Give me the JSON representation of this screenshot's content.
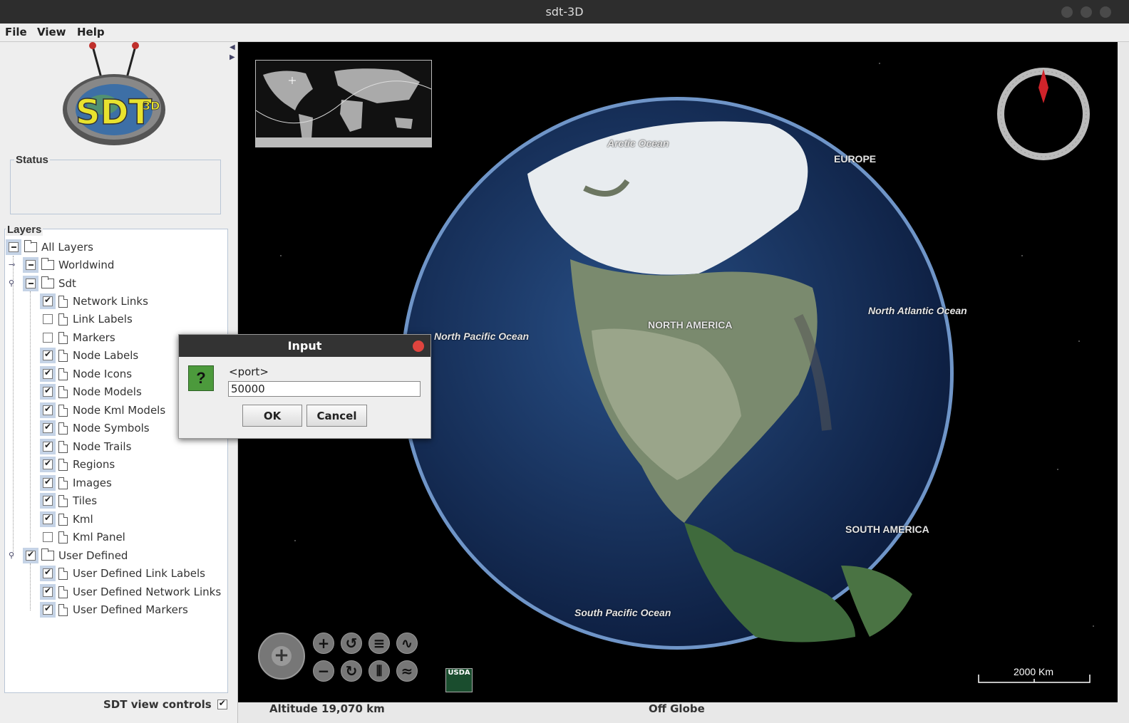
{
  "window": {
    "title": "sdt-3D"
  },
  "menu": {
    "file": "File",
    "view": "View",
    "help": "Help"
  },
  "left": {
    "status_label": "Status",
    "layers_label": "Layers",
    "view_controls_label": "SDT view controls",
    "view_controls_checked": true
  },
  "layers": {
    "all": {
      "label": "All Layers",
      "state": "minus"
    },
    "worldwind": {
      "label": "Worldwind",
      "state": "minus"
    },
    "sdt": {
      "label": "Sdt",
      "state": "minus"
    },
    "sdt_children": [
      {
        "label": "Network Links",
        "checked": true
      },
      {
        "label": "Link Labels",
        "checked": false
      },
      {
        "label": "Markers",
        "checked": false
      },
      {
        "label": "Node Labels",
        "checked": true
      },
      {
        "label": "Node Icons",
        "checked": true
      },
      {
        "label": "Node Models",
        "checked": true
      },
      {
        "label": "Node Kml Models",
        "checked": true
      },
      {
        "label": "Node Symbols",
        "checked": true
      },
      {
        "label": "Node Trails",
        "checked": true
      },
      {
        "label": "Regions",
        "checked": true
      },
      {
        "label": "Images",
        "checked": true
      },
      {
        "label": "Tiles",
        "checked": true
      },
      {
        "label": "Kml",
        "checked": true
      },
      {
        "label": "Kml Panel",
        "checked": false
      }
    ],
    "user_defined": {
      "label": "User Defined",
      "state": "checked"
    },
    "user_children": [
      {
        "label": "User Defined Link Labels",
        "checked": true
      },
      {
        "label": "User Defined Network Links",
        "checked": true
      },
      {
        "label": "User Defined Markers",
        "checked": true
      }
    ]
  },
  "map": {
    "labels": {
      "arctic": "Arctic Ocean",
      "europe": "EUROPE",
      "north_atlantic": "North Atlantic Ocean",
      "north_pacific": "North Pacific Ocean",
      "north_america": "NORTH AMERICA",
      "south_america": "SOUTH AMERICA",
      "south_pacific": "South Pacific Ocean"
    },
    "scale": "2000 Km",
    "usda": "USDA"
  },
  "statusbar": {
    "altitude": "Altitude  19,070 km",
    "position": "Off Globe"
  },
  "dialog": {
    "title": "Input",
    "icon": "?",
    "prompt": "<port>",
    "value": "50000",
    "ok": "OK",
    "cancel": "Cancel"
  }
}
